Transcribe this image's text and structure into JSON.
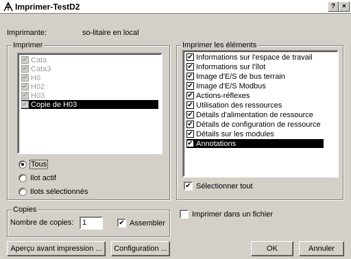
{
  "title": "Imprimer-TestD2",
  "title_buttons": {
    "help": "?",
    "close": "×"
  },
  "printer_label": "Imprimante:",
  "printer_value": "so-litaire en local",
  "print_group": {
    "title": "Imprimer",
    "items": [
      {
        "label": "Cata",
        "checked": true,
        "selected": false
      },
      {
        "label": "Cata3",
        "checked": true,
        "selected": false
      },
      {
        "label": "H0",
        "checked": true,
        "selected": false
      },
      {
        "label": "H02",
        "checked": true,
        "selected": false
      },
      {
        "label": "H03",
        "checked": true,
        "selected": false
      },
      {
        "label": "Copie de H03",
        "checked": true,
        "selected": true
      }
    ],
    "radio_all": "Tous",
    "radio_active": "Ilot actif",
    "radio_selected": "Ilots sélectionnés",
    "radio_value": "Tous"
  },
  "elements_group": {
    "title": "Imprimer les éléments",
    "items": [
      {
        "label": "Informations sur l'espace de travail",
        "checked": true,
        "selected": false
      },
      {
        "label": "Informations sur l'îlot",
        "checked": true,
        "selected": false
      },
      {
        "label": "Image d'E/S de bus terrain",
        "checked": true,
        "selected": false
      },
      {
        "label": "Image d'E/S Modbus",
        "checked": true,
        "selected": false
      },
      {
        "label": "Actions-réflexes",
        "checked": true,
        "selected": false
      },
      {
        "label": "Utilisation des ressources",
        "checked": true,
        "selected": false
      },
      {
        "label": "Détails d'alimentation de ressource",
        "checked": true,
        "selected": false
      },
      {
        "label": "Détails de configuration de ressource",
        "checked": true,
        "selected": false
      },
      {
        "label": "Détails sur les modules",
        "checked": true,
        "selected": false
      },
      {
        "label": "Annotations",
        "checked": true,
        "selected": true
      }
    ],
    "select_all_label": "Sélectionner tout",
    "select_all_checked": true
  },
  "copies_group": {
    "title": "Copies",
    "count_label": "Nombre de copies:",
    "count_value": "1",
    "assemble_label": "Assembler",
    "assemble_checked": true
  },
  "print_to_file_label": "Imprimer dans un fichier",
  "print_to_file_checked": false,
  "buttons": {
    "preview": "Aperçu avant impression ...",
    "config": "Configuration ...",
    "ok": "OK",
    "cancel": "Annuler"
  }
}
